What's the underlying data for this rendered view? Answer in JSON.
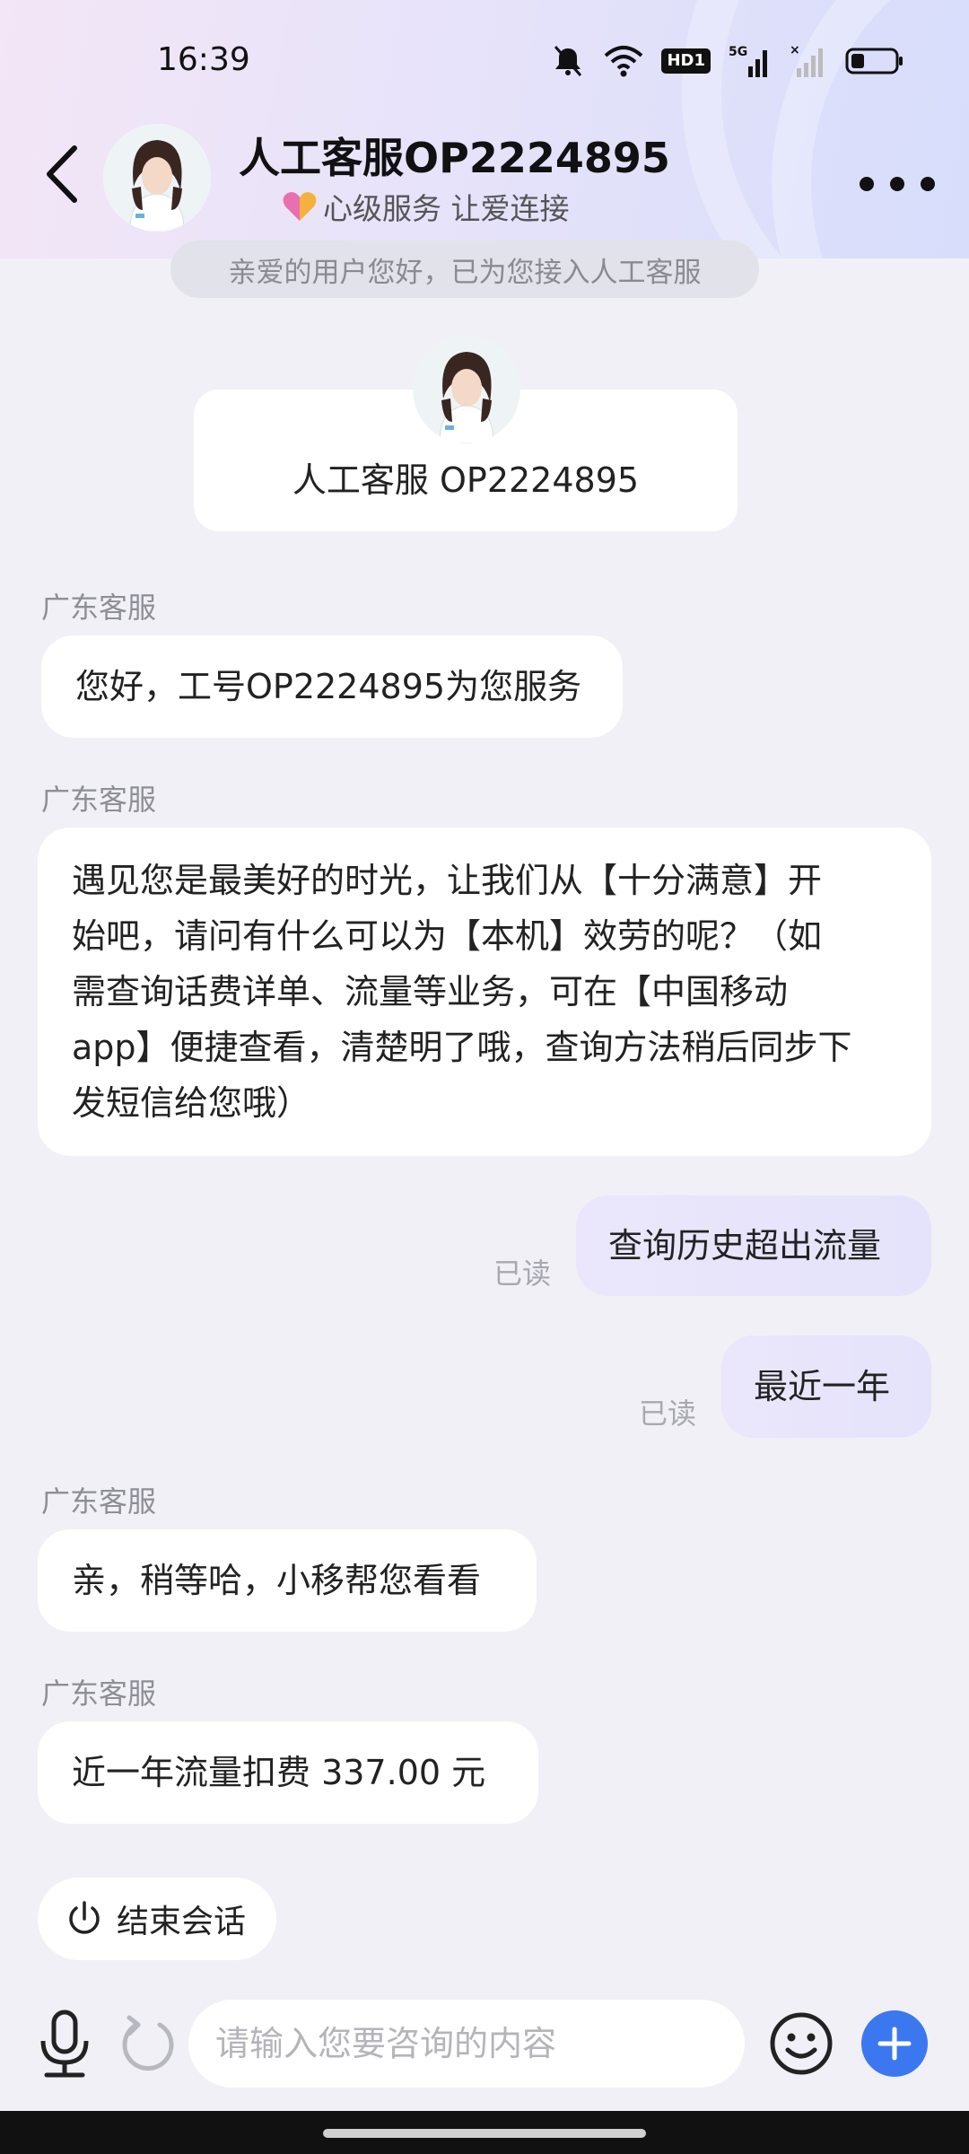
{
  "status_bar": {
    "time": "16:39",
    "hd_label": "HD1",
    "network_label": "5G"
  },
  "header": {
    "title": "人工客服OP2224895",
    "subtitle": "心级服务 让爱连接"
  },
  "system_notice": "亲爱的用户您好，已为您接入人工客服",
  "agent_card": {
    "name": "人工客服 OP2224895"
  },
  "messages": [
    {
      "sender": "广东客服",
      "text": "您好，工号OP2224895为您服务"
    },
    {
      "sender": "广东客服",
      "lines": [
        "遇见您是最美好的时光，让我们从【十分满意】开",
        "始吧，请问有什么可以为【本机】效劳的呢？（如",
        "需查询话费详单、流量等业务，可在【中国移动",
        "app】便捷查看，清楚明了哦，查询方法稍后同步下",
        "发短信给您哦）"
      ]
    },
    {
      "mine": true,
      "text": "查询历史超出流量",
      "status": "已读"
    },
    {
      "mine": true,
      "text": "最近一年",
      "status": "已读"
    },
    {
      "sender": "广东客服",
      "text": "亲，稍等哈，小移帮您看看"
    },
    {
      "sender": "广东客服",
      "text": "近一年流量扣费 337.00 元"
    }
  ],
  "end_button": {
    "label": "结束会话"
  },
  "input": {
    "placeholder": "请输入您要咨询的内容"
  },
  "colors": {
    "accent": "#3b78f0",
    "my_bubble": "#e8e5fb",
    "background": "#f0f0f6"
  },
  "icons": [
    "back-arrow-icon",
    "more-icon",
    "heart-icon",
    "mic-icon",
    "refresh-icon",
    "emoji-icon",
    "plus-icon",
    "power-icon"
  ]
}
